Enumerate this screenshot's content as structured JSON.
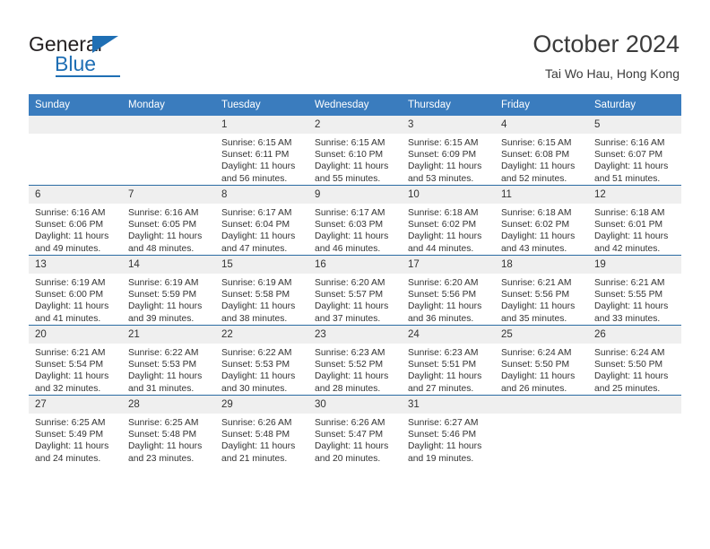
{
  "brand": {
    "name_top": "General",
    "name_bottom": "Blue",
    "accent_color": "#1f6fb4",
    "triangle_icon": "triangle-icon"
  },
  "header": {
    "title": "October 2024",
    "subtitle": "Tai Wo Hau, Hong Kong"
  },
  "calendar": {
    "header_bg": "#3a7cbe",
    "daynum_bg": "#efefef",
    "row_divider_color": "#2b6ca3",
    "weekday_headers": [
      "Sunday",
      "Monday",
      "Tuesday",
      "Wednesday",
      "Thursday",
      "Friday",
      "Saturday"
    ],
    "weeks": [
      [
        {
          "day": "",
          "sunrise": "",
          "sunset": "",
          "daylight": "",
          "empty": true
        },
        {
          "day": "",
          "sunrise": "",
          "sunset": "",
          "daylight": "",
          "empty": true
        },
        {
          "day": "1",
          "sunrise": "Sunrise: 6:15 AM",
          "sunset": "Sunset: 6:11 PM",
          "daylight": "Daylight: 11 hours and 56 minutes."
        },
        {
          "day": "2",
          "sunrise": "Sunrise: 6:15 AM",
          "sunset": "Sunset: 6:10 PM",
          "daylight": "Daylight: 11 hours and 55 minutes."
        },
        {
          "day": "3",
          "sunrise": "Sunrise: 6:15 AM",
          "sunset": "Sunset: 6:09 PM",
          "daylight": "Daylight: 11 hours and 53 minutes."
        },
        {
          "day": "4",
          "sunrise": "Sunrise: 6:15 AM",
          "sunset": "Sunset: 6:08 PM",
          "daylight": "Daylight: 11 hours and 52 minutes."
        },
        {
          "day": "5",
          "sunrise": "Sunrise: 6:16 AM",
          "sunset": "Sunset: 6:07 PM",
          "daylight": "Daylight: 11 hours and 51 minutes."
        }
      ],
      [
        {
          "day": "6",
          "sunrise": "Sunrise: 6:16 AM",
          "sunset": "Sunset: 6:06 PM",
          "daylight": "Daylight: 11 hours and 49 minutes."
        },
        {
          "day": "7",
          "sunrise": "Sunrise: 6:16 AM",
          "sunset": "Sunset: 6:05 PM",
          "daylight": "Daylight: 11 hours and 48 minutes."
        },
        {
          "day": "8",
          "sunrise": "Sunrise: 6:17 AM",
          "sunset": "Sunset: 6:04 PM",
          "daylight": "Daylight: 11 hours and 47 minutes."
        },
        {
          "day": "9",
          "sunrise": "Sunrise: 6:17 AM",
          "sunset": "Sunset: 6:03 PM",
          "daylight": "Daylight: 11 hours and 46 minutes."
        },
        {
          "day": "10",
          "sunrise": "Sunrise: 6:18 AM",
          "sunset": "Sunset: 6:02 PM",
          "daylight": "Daylight: 11 hours and 44 minutes."
        },
        {
          "day": "11",
          "sunrise": "Sunrise: 6:18 AM",
          "sunset": "Sunset: 6:02 PM",
          "daylight": "Daylight: 11 hours and 43 minutes."
        },
        {
          "day": "12",
          "sunrise": "Sunrise: 6:18 AM",
          "sunset": "Sunset: 6:01 PM",
          "daylight": "Daylight: 11 hours and 42 minutes."
        }
      ],
      [
        {
          "day": "13",
          "sunrise": "Sunrise: 6:19 AM",
          "sunset": "Sunset: 6:00 PM",
          "daylight": "Daylight: 11 hours and 41 minutes."
        },
        {
          "day": "14",
          "sunrise": "Sunrise: 6:19 AM",
          "sunset": "Sunset: 5:59 PM",
          "daylight": "Daylight: 11 hours and 39 minutes."
        },
        {
          "day": "15",
          "sunrise": "Sunrise: 6:19 AM",
          "sunset": "Sunset: 5:58 PM",
          "daylight": "Daylight: 11 hours and 38 minutes."
        },
        {
          "day": "16",
          "sunrise": "Sunrise: 6:20 AM",
          "sunset": "Sunset: 5:57 PM",
          "daylight": "Daylight: 11 hours and 37 minutes."
        },
        {
          "day": "17",
          "sunrise": "Sunrise: 6:20 AM",
          "sunset": "Sunset: 5:56 PM",
          "daylight": "Daylight: 11 hours and 36 minutes."
        },
        {
          "day": "18",
          "sunrise": "Sunrise: 6:21 AM",
          "sunset": "Sunset: 5:56 PM",
          "daylight": "Daylight: 11 hours and 35 minutes."
        },
        {
          "day": "19",
          "sunrise": "Sunrise: 6:21 AM",
          "sunset": "Sunset: 5:55 PM",
          "daylight": "Daylight: 11 hours and 33 minutes."
        }
      ],
      [
        {
          "day": "20",
          "sunrise": "Sunrise: 6:21 AM",
          "sunset": "Sunset: 5:54 PM",
          "daylight": "Daylight: 11 hours and 32 minutes."
        },
        {
          "day": "21",
          "sunrise": "Sunrise: 6:22 AM",
          "sunset": "Sunset: 5:53 PM",
          "daylight": "Daylight: 11 hours and 31 minutes."
        },
        {
          "day": "22",
          "sunrise": "Sunrise: 6:22 AM",
          "sunset": "Sunset: 5:53 PM",
          "daylight": "Daylight: 11 hours and 30 minutes."
        },
        {
          "day": "23",
          "sunrise": "Sunrise: 6:23 AM",
          "sunset": "Sunset: 5:52 PM",
          "daylight": "Daylight: 11 hours and 28 minutes."
        },
        {
          "day": "24",
          "sunrise": "Sunrise: 6:23 AM",
          "sunset": "Sunset: 5:51 PM",
          "daylight": "Daylight: 11 hours and 27 minutes."
        },
        {
          "day": "25",
          "sunrise": "Sunrise: 6:24 AM",
          "sunset": "Sunset: 5:50 PM",
          "daylight": "Daylight: 11 hours and 26 minutes."
        },
        {
          "day": "26",
          "sunrise": "Sunrise: 6:24 AM",
          "sunset": "Sunset: 5:50 PM",
          "daylight": "Daylight: 11 hours and 25 minutes."
        }
      ],
      [
        {
          "day": "27",
          "sunrise": "Sunrise: 6:25 AM",
          "sunset": "Sunset: 5:49 PM",
          "daylight": "Daylight: 11 hours and 24 minutes."
        },
        {
          "day": "28",
          "sunrise": "Sunrise: 6:25 AM",
          "sunset": "Sunset: 5:48 PM",
          "daylight": "Daylight: 11 hours and 23 minutes."
        },
        {
          "day": "29",
          "sunrise": "Sunrise: 6:26 AM",
          "sunset": "Sunset: 5:48 PM",
          "daylight": "Daylight: 11 hours and 21 minutes."
        },
        {
          "day": "30",
          "sunrise": "Sunrise: 6:26 AM",
          "sunset": "Sunset: 5:47 PM",
          "daylight": "Daylight: 11 hours and 20 minutes."
        },
        {
          "day": "31",
          "sunrise": "Sunrise: 6:27 AM",
          "sunset": "Sunset: 5:46 PM",
          "daylight": "Daylight: 11 hours and 19 minutes."
        },
        {
          "day": "",
          "sunrise": "",
          "sunset": "",
          "daylight": "",
          "empty": true
        },
        {
          "day": "",
          "sunrise": "",
          "sunset": "",
          "daylight": "",
          "empty": true
        }
      ]
    ]
  }
}
